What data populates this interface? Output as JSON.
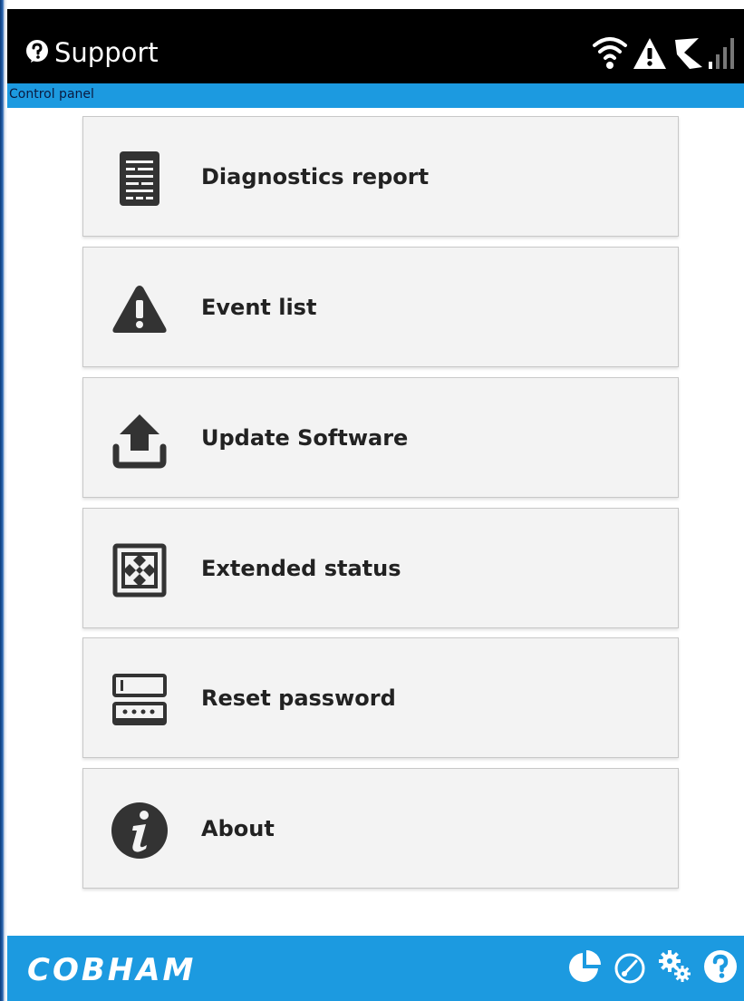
{
  "header": {
    "title": "Support",
    "title_icon": "question-circle-icon",
    "status_icons": [
      "wifi-icon",
      "warning-icon",
      "satellite-pointing-icon",
      "signal-strength-icon"
    ]
  },
  "breadcrumb": "Control panel",
  "menu": {
    "items": [
      {
        "label": "Diagnostics report",
        "icon": "document-report-icon"
      },
      {
        "label": "Event list",
        "icon": "warning-triangle-icon"
      },
      {
        "label": "Update Software",
        "icon": "upload-icon"
      },
      {
        "label": "Extended status",
        "icon": "expand-arrows-icon"
      },
      {
        "label": "Reset password",
        "icon": "password-field-icon"
      },
      {
        "label": "About",
        "icon": "info-icon"
      }
    ]
  },
  "footer": {
    "brand": "COBHAM",
    "icons": [
      "dashboard-pie-icon",
      "speedometer-icon",
      "settings-gears-icon",
      "help-icon"
    ]
  },
  "colors": {
    "header_bg": "#000000",
    "accent": "#1c9ae0",
    "item_bg": "#f3f3f3",
    "icon_dark": "#333333"
  }
}
